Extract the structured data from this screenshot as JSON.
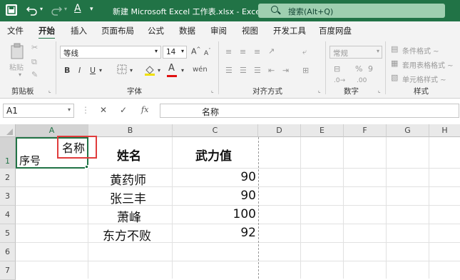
{
  "title_bar": {
    "file_title": "新建 Microsoft Excel 工作表.xlsx  -  Excel",
    "search_placeholder": "搜索(Alt+Q)"
  },
  "tabs": [
    "文件",
    "开始",
    "插入",
    "页面布局",
    "公式",
    "数据",
    "审阅",
    "视图",
    "开发工具",
    "百度网盘"
  ],
  "active_tab": "开始",
  "ribbon": {
    "clipboard": {
      "paste_label": "粘贴",
      "group_label": "剪贴板"
    },
    "font": {
      "font_name": "等线",
      "font_size": "14",
      "group_label": "字体"
    },
    "alignment": {
      "group_label": "对齐方式"
    },
    "number": {
      "format": "常规",
      "group_label": "数字"
    },
    "styles": {
      "items": [
        "条件格式 ~",
        "套用表格格式 ~",
        "单元格样式 ~"
      ],
      "group_label": "样式"
    }
  },
  "formula_bar": {
    "name_box": "A1",
    "fx": "fx",
    "formula": "名称"
  },
  "sheet": {
    "columns": [
      "A",
      "B",
      "C",
      "D",
      "E",
      "F",
      "G",
      "H"
    ],
    "rows": [
      "1",
      "2",
      "3",
      "4",
      "5",
      "6",
      "7"
    ],
    "a1_top": "名称",
    "a1_bottom": "序号",
    "header_name": "姓名",
    "header_power": "武力值",
    "names": [
      "黄药师",
      "张三丰",
      "萧峰",
      "东方不败"
    ],
    "powers": [
      "90",
      "90",
      "100",
      "92"
    ]
  },
  "colors": {
    "accent": "#217346",
    "highlight_box": "#e03c3c"
  }
}
